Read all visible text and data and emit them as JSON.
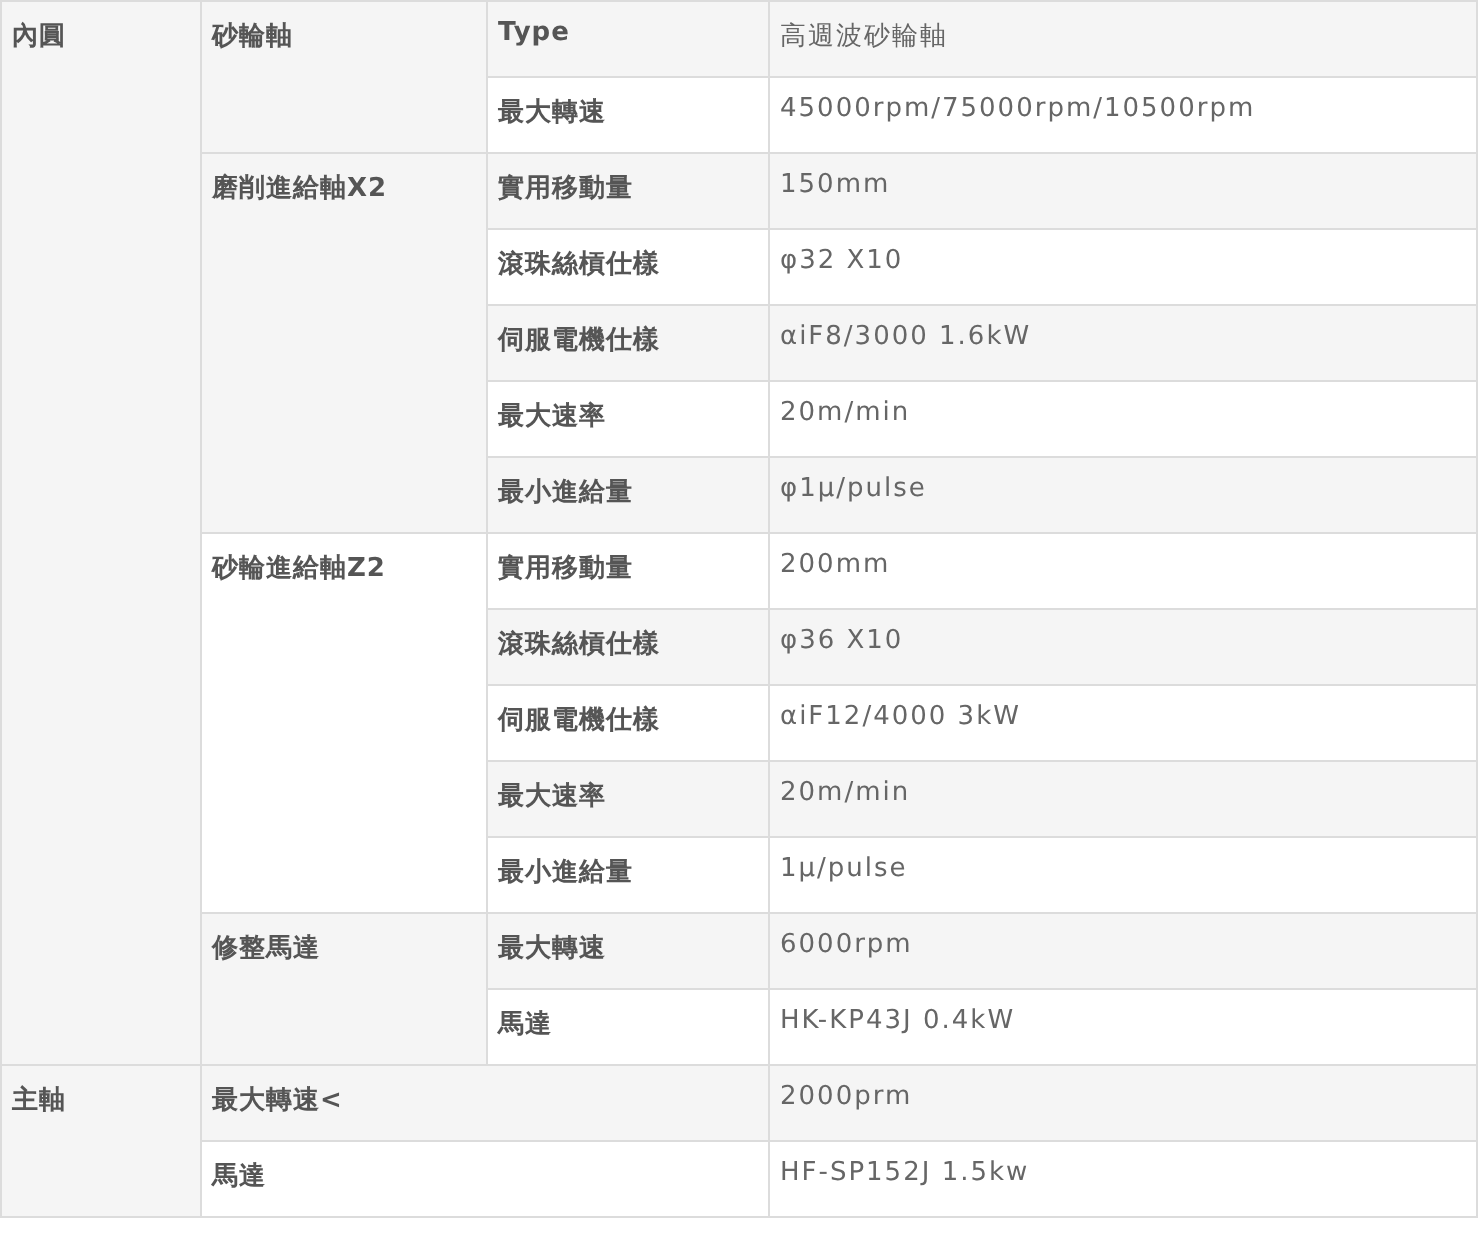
{
  "sections": [
    {
      "label": "內圓",
      "items": [
        {
          "kind": "group",
          "label": "砂輪軸",
          "rows": [
            {
              "label": "Type",
              "value": "高週波砂輪軸"
            },
            {
              "label": "最大轉速",
              "value": "45000rpm/75000rpm/10500rpm"
            }
          ]
        },
        {
          "kind": "group",
          "label": "磨削進給軸X2",
          "rows": [
            {
              "label": "實用移動量",
              "value": "150mm"
            },
            {
              "label": "滾珠絲槓仕樣",
              "value": "φ32 X10"
            },
            {
              "label": "伺服電機仕樣",
              "value": "αiF8/3000 1.6kW"
            },
            {
              "label": "最大速率",
              "value": "20m/min"
            },
            {
              "label": "最小進給量",
              "value": "φ1μ/pulse"
            }
          ]
        },
        {
          "kind": "group",
          "label": "砂輪進給軸Z2",
          "rows": [
            {
              "label": "實用移動量",
              "value": "200mm"
            },
            {
              "label": "滾珠絲槓仕樣",
              "value": "φ36 X10"
            },
            {
              "label": "伺服電機仕樣",
              "value": "αiF12/4000 3kW"
            },
            {
              "label": "最大速率",
              "value": "20m/min"
            },
            {
              "label": "最小進給量",
              "value": "1μ/pulse"
            }
          ]
        },
        {
          "kind": "group",
          "label": "修整馬達",
          "rows": [
            {
              "label": "最大轉速",
              "value": "6000rpm"
            },
            {
              "label": "馬達",
              "value": "HK-KP43J 0.4kW"
            }
          ]
        }
      ]
    },
    {
      "label": "主軸",
      "items": [
        {
          "kind": "spec",
          "label": "最大轉速<",
          "value": "2000prm"
        },
        {
          "kind": "spec",
          "label": "馬達",
          "value": "HF-SP152J 1.5kw"
        }
      ]
    }
  ]
}
